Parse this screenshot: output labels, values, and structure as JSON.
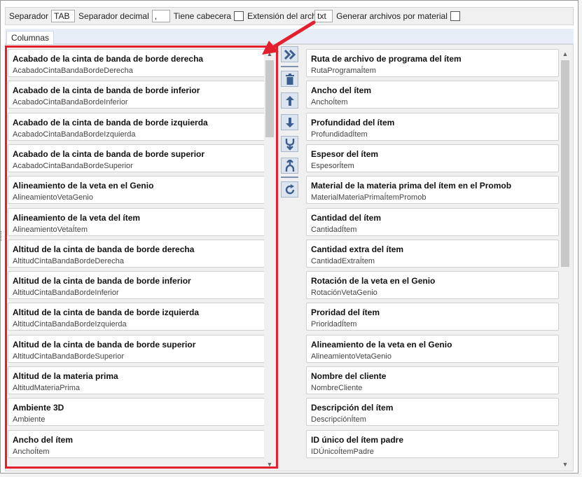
{
  "toolbar": {
    "separator_label": "Separador",
    "separator_value": "TAB",
    "decimal_label": "Separador decimal",
    "decimal_value": ",",
    "header_label": "Tiene cabecera",
    "extension_label": "Extensión del archivo",
    "extension_value": "txt",
    "per_material_label": "Generar archivos por material"
  },
  "tabs": [
    {
      "label": "Columnas"
    }
  ],
  "available_columns": [
    {
      "title": "Acabado de la cinta de banda de borde derecha",
      "id": "AcabadoCintaBandaBordeDerecha"
    },
    {
      "title": "Acabado de la cinta de banda de borde inferior",
      "id": "AcabadoCintaBandaBordeInferior"
    },
    {
      "title": "Acabado de la cinta de banda de borde izquierda",
      "id": "AcabadoCintaBandaBordeIzquierda"
    },
    {
      "title": "Acabado de la cinta de banda de borde superior",
      "id": "AcabadoCintaBandaBordeSuperior"
    },
    {
      "title": "Alineamiento de la veta en el Genio",
      "id": "AlineamientoVetaGenio"
    },
    {
      "title": "Alineamiento de la veta del ítem",
      "id": "AlineamientoVetaÍtem"
    },
    {
      "title": "Altitud de la cinta de banda de borde derecha",
      "id": "AltitudCintaBandaBordeDerecha"
    },
    {
      "title": "Altitud de la cinta de banda de borde inferior",
      "id": "AltitudCintaBandaBordeInferior"
    },
    {
      "title": "Altitud de la cinta de banda de borde izquierda",
      "id": "AltitudCintaBandaBordeIzquierda"
    },
    {
      "title": "Altitud de la cinta de banda de borde superior",
      "id": "AltitudCintaBandaBordeSuperior"
    },
    {
      "title": "Altitud de la materia prima",
      "id": "AltitudMateriaPrima"
    },
    {
      "title": "Ambiente 3D",
      "id": "Ambiente"
    },
    {
      "title": "Ancho del ítem",
      "id": "AnchoÍtem"
    }
  ],
  "selected_columns": [
    {
      "title": "Ruta de archivo de programa del ítem",
      "id": "RutaProgramaÍtem"
    },
    {
      "title": "Ancho del ítem",
      "id": "AnchoÍtem"
    },
    {
      "title": "Profundidad del ítem",
      "id": "ProfundidadÍtem"
    },
    {
      "title": "Espesor del ítem",
      "id": "EspesorÍtem"
    },
    {
      "title": "Material de la materia prima del ítem en el Promob",
      "id": "MaterialMateriaPrimaÍtemPromob"
    },
    {
      "title": "Cantidad del ítem",
      "id": "CantidadÍtem"
    },
    {
      "title": "Cantidad extra del ítem",
      "id": "CantidadExtraÍtem"
    },
    {
      "title": "Rotación de la veta en el Genio",
      "id": "RotaciónVetaGenio"
    },
    {
      "title": "Proridad del ítem",
      "id": "PrioridadÍtem"
    },
    {
      "title": "Alineamiento de la veta en el Genio",
      "id": "AlineamientoVetaGenio"
    },
    {
      "title": "Nombre del cliente",
      "id": "NombreCliente"
    },
    {
      "title": "Descripción del ítem",
      "id": "DescripciónÍtem"
    },
    {
      "title": "ID único del ítem padre",
      "id": "IDÚnicoÍtemPadre"
    }
  ],
  "action_buttons": [
    {
      "name": "move-all-right-button",
      "icon": "double-chevron-right-icon"
    },
    {
      "name": "delete-button",
      "icon": "trash-icon"
    },
    {
      "name": "move-up-button",
      "icon": "arrow-up-icon"
    },
    {
      "name": "move-down-button",
      "icon": "arrow-down-icon"
    },
    {
      "name": "merge-button",
      "icon": "merge-icon"
    },
    {
      "name": "split-button",
      "icon": "split-icon"
    },
    {
      "name": "refresh-button",
      "icon": "refresh-icon"
    }
  ],
  "colors": {
    "accent_highlight": "#e5202e",
    "button_icon": "#3a5f8f",
    "button_background": "#dce4ef"
  }
}
